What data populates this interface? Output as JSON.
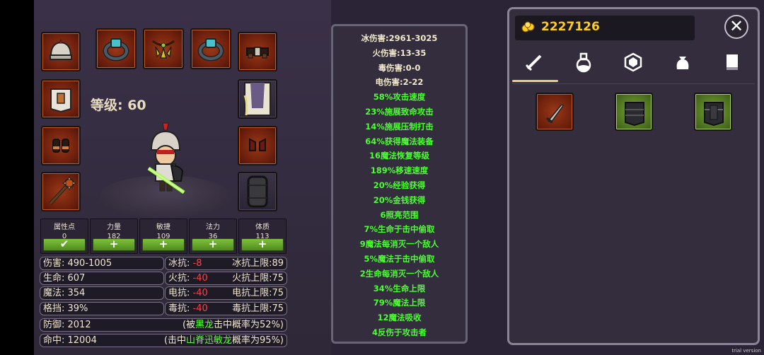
{
  "character": {
    "level_label": "等级: 60"
  },
  "equipment_slots": [
    {
      "name": "helmet-slot",
      "icon": "helmet-icon"
    },
    {
      "name": "ring-left-slot",
      "icon": "ring-icon"
    },
    {
      "name": "amulet-slot",
      "icon": "amulet-icon"
    },
    {
      "name": "ring-right-slot",
      "icon": "ring-icon"
    },
    {
      "name": "belt-slot",
      "icon": "belt-icon"
    },
    {
      "name": "armor-slot",
      "icon": "chest-armor-icon"
    },
    {
      "name": "cape-slot",
      "icon": "cape-icon"
    },
    {
      "name": "gloves-slot",
      "icon": "gloves-icon"
    },
    {
      "name": "boots-slot",
      "icon": "boots-icon"
    },
    {
      "name": "weapon-slot",
      "icon": "mace-icon"
    },
    {
      "name": "shield-slot",
      "icon": "shield-icon"
    }
  ],
  "attributes": [
    {
      "title": "属性点",
      "value": "0",
      "button": "✔"
    },
    {
      "title": "力量",
      "value": "182",
      "button": "+"
    },
    {
      "title": "敏捷",
      "value": "109",
      "button": "+"
    },
    {
      "title": "法力",
      "value": "36",
      "button": "+"
    },
    {
      "title": "体质",
      "value": "113",
      "button": "+"
    }
  ],
  "stats": {
    "damage": "伤害: 490-1005",
    "life": "生命: 607",
    "mana": "魔法: 354",
    "block": "格挡: 39%",
    "defense": "防御: 2012",
    "hit": "命中: 12004",
    "cold_res_label": "冰抗:",
    "cold_res_value": "-8",
    "cold_cap": "冰抗上限:89",
    "fire_res_label": "火抗:",
    "fire_res_value": "-40",
    "fire_cap": "火抗上限:75",
    "light_res_label": "电抗:",
    "light_res_value": "-40",
    "light_cap": "电抗上限:75",
    "poison_res_label": "毒抗:",
    "poison_res_value": "-40",
    "poison_cap": "毒抗上限:75",
    "hit_chance_1_pre": "(被",
    "hit_chance_1_enemy": "黑龙",
    "hit_chance_1_post": "击中概率为52%)",
    "hit_chance_2_pre": "(击中",
    "hit_chance_2_enemy": "山脊迅敏龙",
    "hit_chance_2_post": "概率为95%)"
  },
  "item_properties": [
    {
      "text": "冰伤害:2961-3025",
      "color": "white"
    },
    {
      "text": "火伤害:13-35",
      "color": "white"
    },
    {
      "text": "毒伤害:0-0",
      "color": "white"
    },
    {
      "text": "电伤害:2-22",
      "color": "white"
    },
    {
      "text": "58%攻击速度",
      "color": "green"
    },
    {
      "text": "23%施展致命攻击",
      "color": "green"
    },
    {
      "text": "14%施展压制打击",
      "color": "green"
    },
    {
      "text": "64%获得魔法装备",
      "color": "green"
    },
    {
      "text": "16魔法恢复等级",
      "color": "green"
    },
    {
      "text": "189%移速速度",
      "color": "green"
    },
    {
      "text": "20%经验获得",
      "color": "green"
    },
    {
      "text": "20%金钱获得",
      "color": "green"
    },
    {
      "text": "6照亮范围",
      "color": "green"
    },
    {
      "text": "7%生命于击中偷取",
      "color": "green"
    },
    {
      "text": "9魔法每消灭一个敌人",
      "color": "green"
    },
    {
      "text": "5%魔法于击中偷取",
      "color": "green"
    },
    {
      "text": "2生命每消灭一个敌人",
      "color": "green"
    },
    {
      "text": "34%生命上限",
      "color": "green"
    },
    {
      "text": "79%魔法上限",
      "color": "green"
    },
    {
      "text": "12魔法吸收",
      "color": "green"
    },
    {
      "text": "4反伤于攻击者",
      "color": "green"
    }
  ],
  "inventory": {
    "gold": "2227126",
    "tabs": [
      "weapon-tab-icon",
      "potion-tab-icon",
      "gem-tab-icon",
      "bag-tab-icon",
      "book-tab-icon"
    ],
    "items": [
      {
        "name": "inventory-item-dagger",
        "icon": "dagger-icon"
      },
      {
        "name": "inventory-item-armor-1",
        "icon": "armor-icon"
      },
      {
        "name": "inventory-item-armor-2",
        "icon": "armor-icon"
      }
    ]
  },
  "watermark": "trial version"
}
